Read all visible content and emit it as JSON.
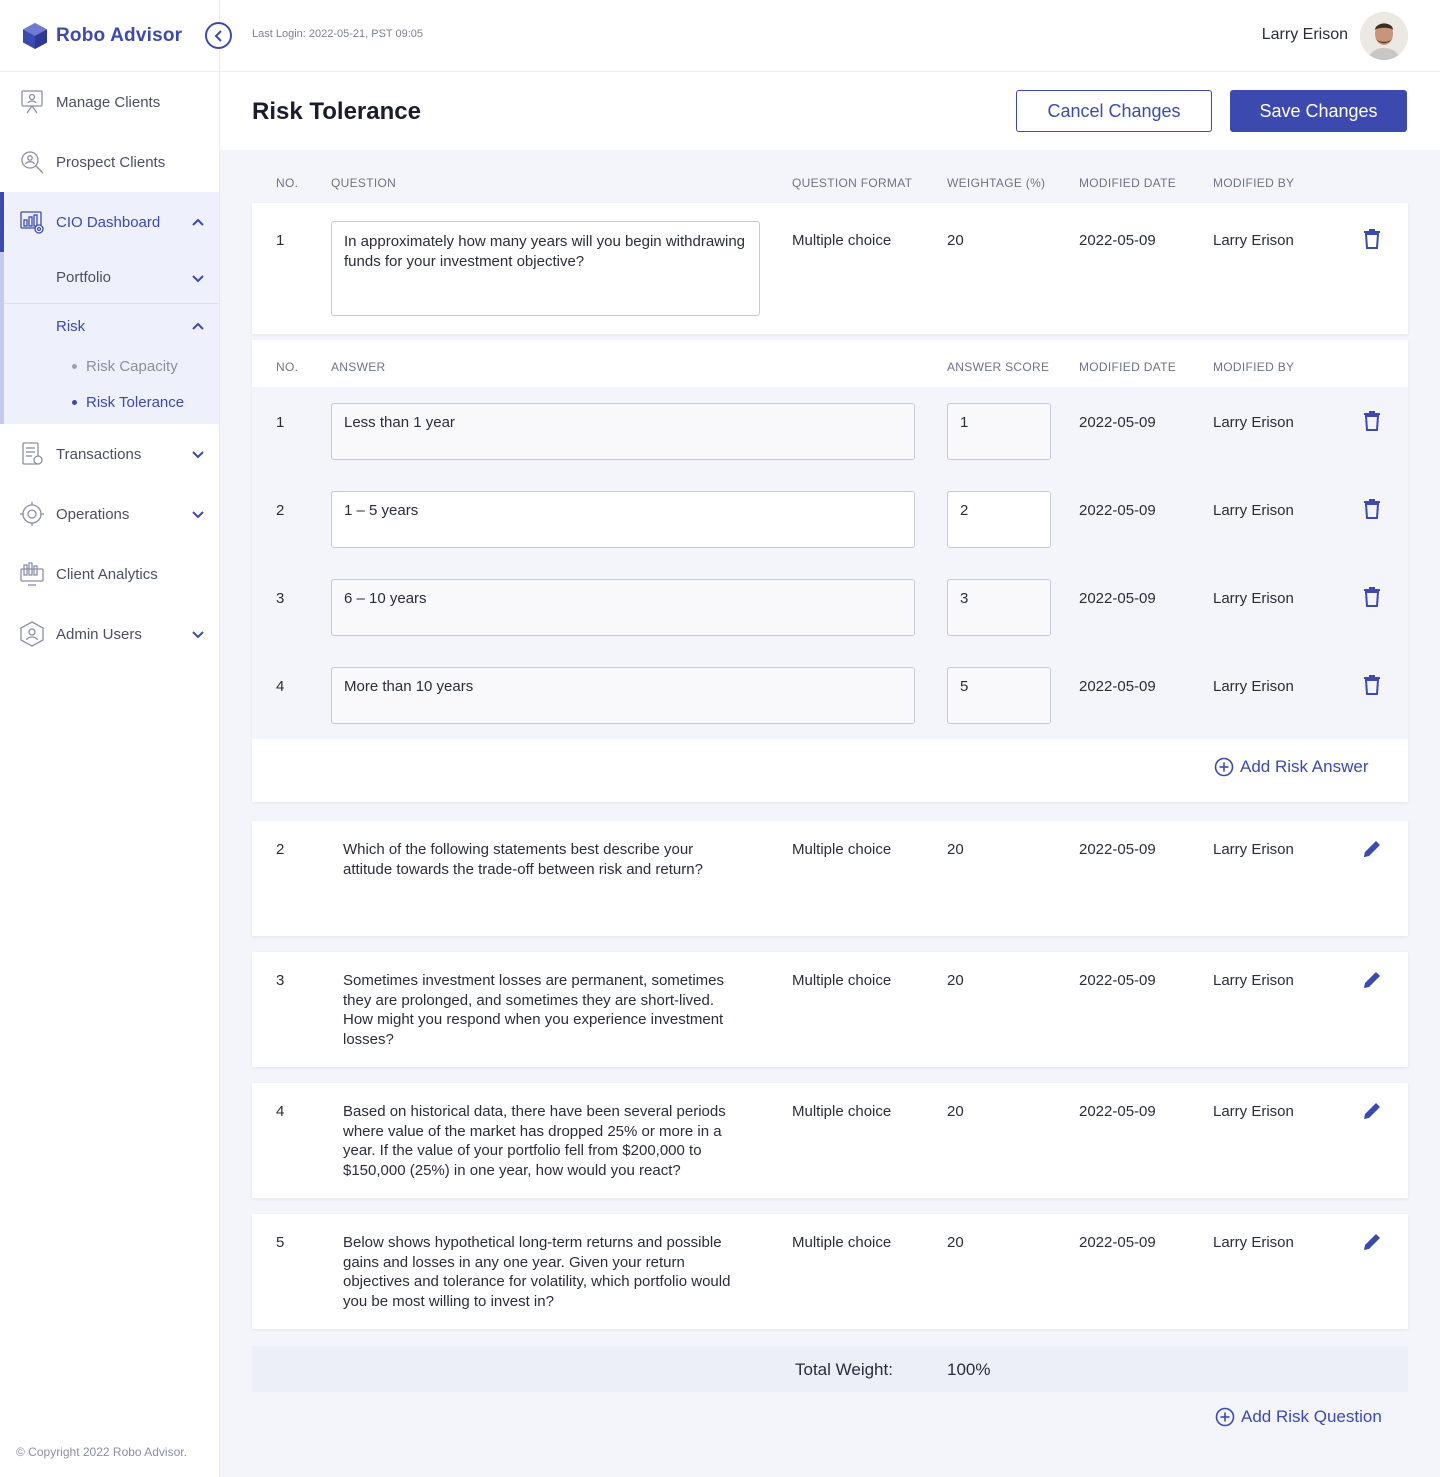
{
  "brand": {
    "name": "Robo Advisor"
  },
  "topbar": {
    "last_login": "Last Login: 2022-05-21, PST 09:05",
    "user_name": "Larry Erison"
  },
  "sidebar": {
    "items": [
      {
        "label": "Manage Clients",
        "icon": "clients-icon"
      },
      {
        "label": "Prospect Clients",
        "icon": "prospect-icon"
      },
      {
        "label": "CIO Dashboard",
        "icon": "dashboard-icon"
      },
      {
        "label": "Transactions",
        "icon": "transactions-icon"
      },
      {
        "label": "Operations",
        "icon": "operations-icon"
      },
      {
        "label": "Client Analytics",
        "icon": "analytics-icon"
      },
      {
        "label": "Admin Users",
        "icon": "admin-icon"
      }
    ],
    "sub": {
      "portfolio": "Portfolio",
      "risk": "Risk",
      "risk_capacity": "Risk Capacity",
      "risk_tolerance": "Risk Tolerance"
    },
    "copyright": "© Copyright 2022 Robo Advisor."
  },
  "header": {
    "title": "Risk Tolerance",
    "cancel_label": "Cancel Changes",
    "save_label": "Save Changes"
  },
  "question_columns": {
    "no": "NO.",
    "question": "QUESTION",
    "format": "QUESTION FORMAT",
    "weight": "WEIGHTAGE (%)",
    "date": "MODIFIED DATE",
    "by": "MODIFIED BY"
  },
  "answer_columns": {
    "no": "NO.",
    "answer": "ANSWER",
    "score": "ANSWER SCORE",
    "date": "MODIFIED DATE",
    "by": "MODIFIED BY"
  },
  "questions": [
    {
      "no": "1",
      "text": "In approximately how many years will you begin withdrawing funds for your investment objective?",
      "format": "Multiple choice",
      "weight": "20",
      "date": "2022-05-09",
      "by": "Larry Erison"
    },
    {
      "no": "2",
      "text": "Which of the following statements best describe your attitude towards the trade-off between risk and return?",
      "format": "Multiple choice",
      "weight": "20",
      "date": "2022-05-09",
      "by": "Larry Erison"
    },
    {
      "no": "3",
      "text": "Sometimes investment losses are permanent, sometimes they are prolonged, and sometimes they are short-lived. How might you respond when you experience investment losses?",
      "format": "Multiple choice",
      "weight": "20",
      "date": "2022-05-09",
      "by": "Larry Erison"
    },
    {
      "no": "4",
      "text": "Based on historical data, there have been several periods where value of the market has dropped 25% or more in a year. If the value of your portfolio fell from $200,000 to $150,000 (25%) in one year, how would you react?",
      "format": "Multiple choice",
      "weight": "20",
      "date": "2022-05-09",
      "by": "Larry Erison"
    },
    {
      "no": "5",
      "text": "Below shows hypothetical long-term returns and possible gains and losses in any one year. Given your return objectives and tolerance for volatility, which portfolio would you be most willing to invest in?",
      "format": "Multiple choice",
      "weight": "20",
      "date": "2022-05-09",
      "by": "Larry Erison"
    }
  ],
  "answers": [
    {
      "no": "1",
      "text": "Less than 1 year",
      "score": "1",
      "date": "2022-05-09",
      "by": "Larry Erison"
    },
    {
      "no": "2",
      "text": "1 – 5 years",
      "score": "2",
      "date": "2022-05-09",
      "by": "Larry Erison"
    },
    {
      "no": "3",
      "text": "6 – 10 years",
      "score": "3",
      "date": "2022-05-09",
      "by": "Larry Erison"
    },
    {
      "no": "4",
      "text": "More than 10 years",
      "score": "5",
      "date": "2022-05-09",
      "by": "Larry Erison"
    }
  ],
  "add_answer_label": "Add Risk Answer",
  "add_question_label": "Add Risk Question",
  "total": {
    "label": "Total Weight:",
    "value": "100%"
  },
  "colors": {
    "accent": "#3c4ab0",
    "background": "#f4f5fa"
  }
}
